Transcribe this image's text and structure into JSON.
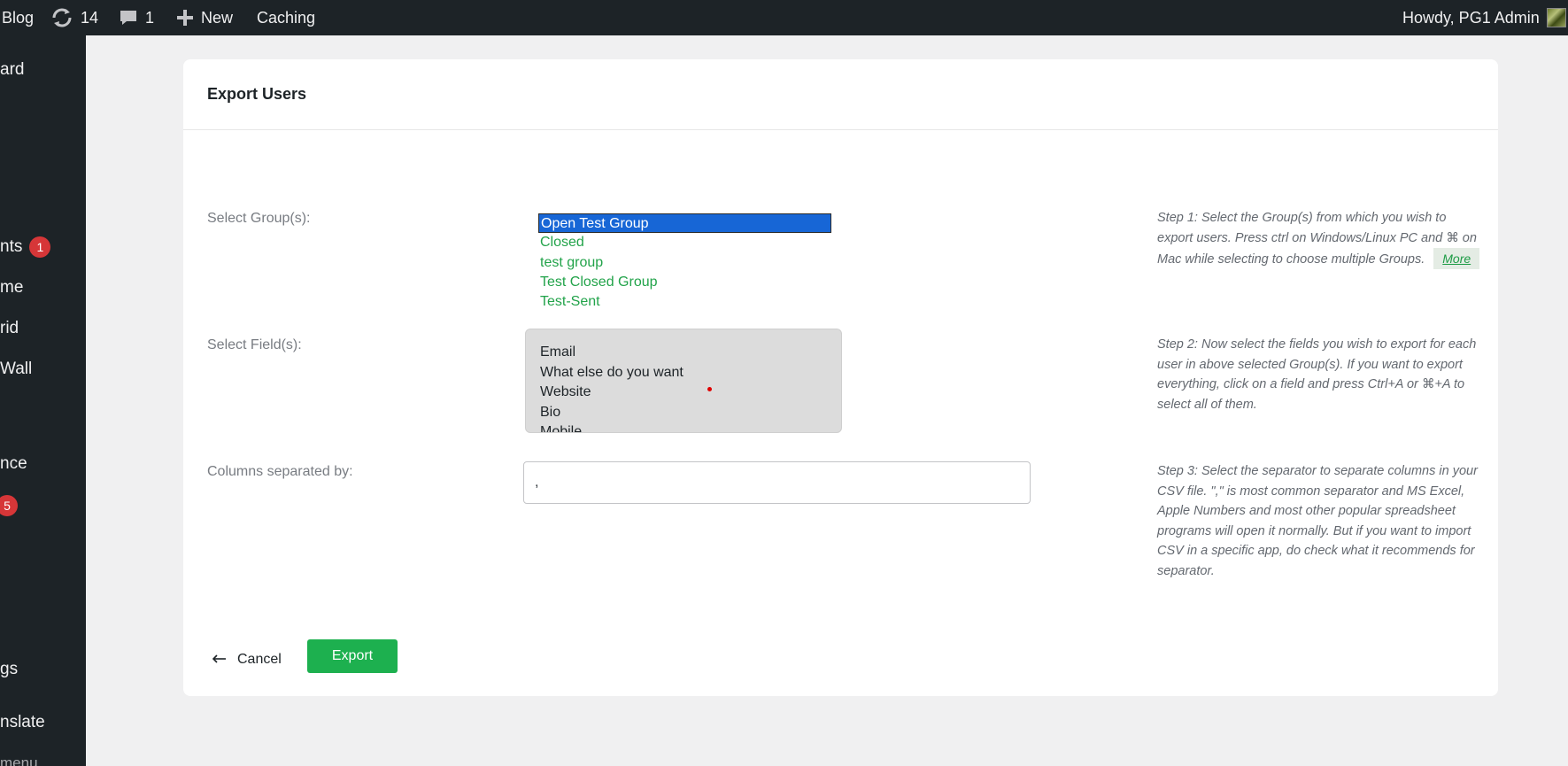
{
  "adminbar": {
    "site": "Blog",
    "updates_count": "14",
    "comments_count": "1",
    "new_label": "New",
    "caching_label": "Caching",
    "howdy": "Howdy, PG1 Admin"
  },
  "sidebar": {
    "items": [
      {
        "label": "ard"
      },
      {
        "label": "nts",
        "badge": "1"
      },
      {
        "label": "me"
      },
      {
        "label": "rid"
      },
      {
        "label": "Wall"
      },
      {
        "label": "nce"
      },
      {
        "label": "",
        "badge": "5"
      },
      {
        "label": "gs"
      },
      {
        "label": "nslate"
      },
      {
        "label": "menu"
      }
    ]
  },
  "page": {
    "title": "Export Users",
    "group_label": "Select Group(s):",
    "groups": [
      "Open Test Group",
      "Closed",
      "test group",
      "Test Closed Group",
      "Test-Sent"
    ],
    "group_selected": "Open Test Group",
    "fields_label": "Select Field(s):",
    "fields": [
      "Email",
      "What else do you want",
      "Website",
      "Bio",
      "Mobile"
    ],
    "separator_label": "Columns separated by:",
    "separator_value": ",",
    "step1_help": "Step 1: Select the Group(s) from which you wish to export users. Press ctrl on Windows/Linux PC and ⌘ on Mac while selecting to choose multiple Groups.",
    "more_label": "More",
    "step2_help": "Step 2: Now select the fields you wish to export for each user in above selected Group(s). If you want to export everything, click on a field and press Ctrl+A or ⌘+A to select all of them.",
    "step3_help": "Step 3: Select the separator to separate columns in your CSV file. \",\" is most common separator and MS Excel, Apple Numbers and most other popular spreadsheet programs will open it normally. But if you want to import CSV in a specific app, do check what it recommends for separator.",
    "cancel_label": "Cancel",
    "export_label": "Export"
  },
  "colors": {
    "admin_bg": "#1d2327",
    "accent_green": "#1db04f",
    "selected_blue": "#1766d6",
    "badge_red": "#d63638"
  }
}
